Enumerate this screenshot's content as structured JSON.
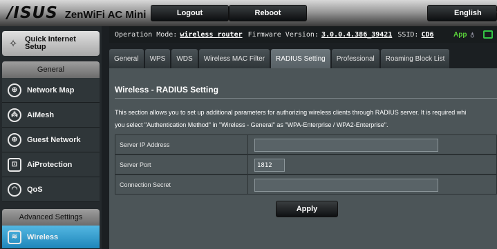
{
  "header": {
    "brand": "/ISUS",
    "model": "ZenWiFi AC Mini",
    "logout_label": "Logout",
    "reboot_label": "Reboot",
    "language": "English"
  },
  "sidebar": {
    "quick_setup": "Quick Internet Setup",
    "general_header": "General",
    "general_items": [
      {
        "label": "Network Map",
        "icon": "network-map-icon"
      },
      {
        "label": "AiMesh",
        "icon": "aimesh-icon"
      },
      {
        "label": "Guest Network",
        "icon": "guest-network-icon"
      },
      {
        "label": "AiProtection",
        "icon": "lock-icon"
      },
      {
        "label": "QoS",
        "icon": "speedometer-icon"
      }
    ],
    "advanced_header": "Advanced Settings",
    "advanced_items": [
      {
        "label": "Wireless",
        "icon": "wireless-icon",
        "active": true
      }
    ]
  },
  "info": {
    "op_mode_label": "Operation Mode:",
    "op_mode_value": "wireless router",
    "fw_label": "Firmware Version:",
    "fw_value": "3.0.0.4.386_39421",
    "ssid_label": "SSID:",
    "ssid_value": "CD6",
    "app_label": "App"
  },
  "tabs": [
    {
      "label": "General"
    },
    {
      "label": "WPS"
    },
    {
      "label": "WDS"
    },
    {
      "label": "Wireless MAC Filter"
    },
    {
      "label": "RADIUS Setting",
      "active": true
    },
    {
      "label": "Professional"
    },
    {
      "label": "Roaming Block List"
    }
  ],
  "main": {
    "title": "Wireless - RADIUS Setting",
    "description_line1": "This section allows you to set up additional parameters for authorizing wireless clients through RADIUS server. It is required whi",
    "description_line2": "you select \"Authentication Method\" in \"Wireless - General\" as \"WPA-Enterprise / WPA2-Enterprise\".",
    "fields": [
      {
        "label": "Server IP Address",
        "value": ""
      },
      {
        "label": "Server Port",
        "value": "1812"
      },
      {
        "label": "Connection Secret",
        "value": ""
      }
    ],
    "apply_label": "Apply"
  },
  "colors": {
    "active_menu": "#1f86ba",
    "app_green": "#5ad33a"
  }
}
